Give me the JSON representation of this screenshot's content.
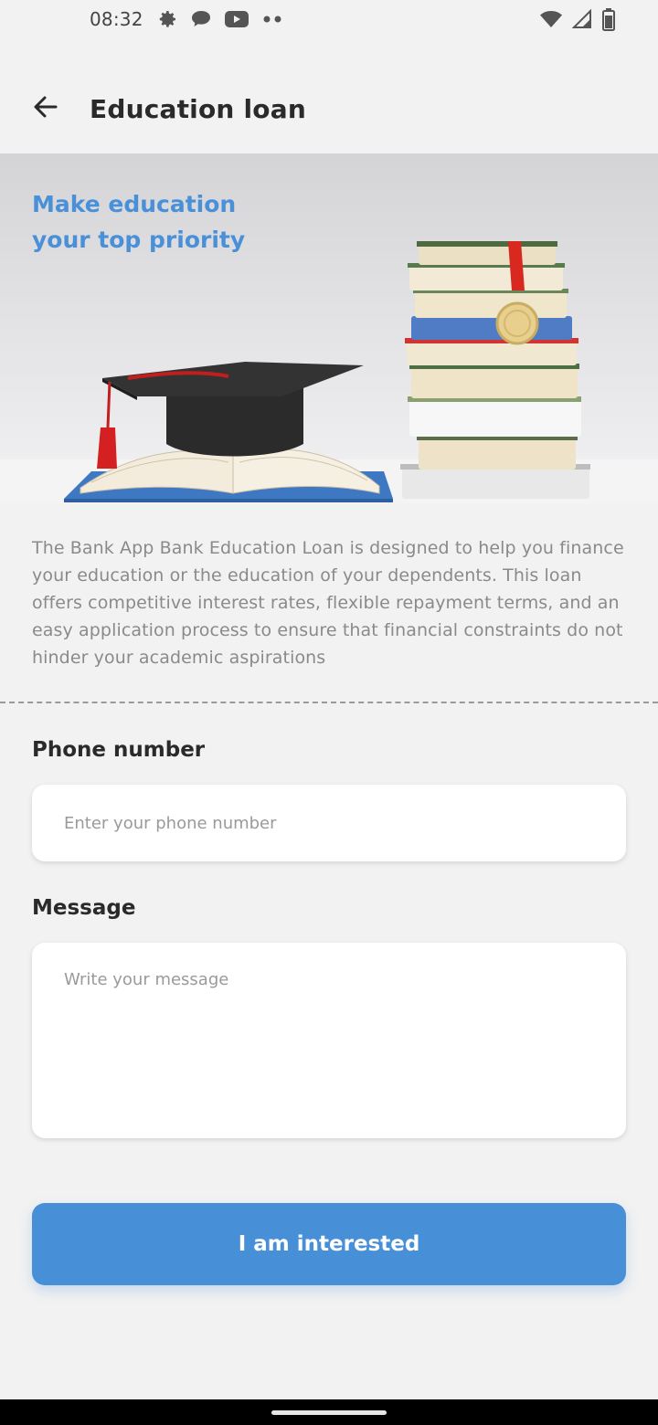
{
  "status_bar": {
    "time": "08:32",
    "left_icons": [
      "gear-icon",
      "chat-bubble-icon",
      "youtube-icon",
      "more-dots-icon"
    ],
    "right_icons": [
      "wifi-icon",
      "signal-icon",
      "battery-icon"
    ]
  },
  "app_bar": {
    "back_icon": "arrow-left-icon",
    "title": "Education loan"
  },
  "hero": {
    "tagline_line1": "Make education",
    "tagline_line2": "your top priority",
    "tagline_color": "#4a90d9"
  },
  "description": "The Bank App Bank Education Loan is designed to help you finance your education or the education of your dependents. This loan offers competitive interest rates, flexible repayment terms, and an easy application process to ensure that financial constraints do not hinder your academic aspirations",
  "form": {
    "phone_label": "Phone number",
    "phone_placeholder": "Enter your phone number",
    "phone_value": "",
    "message_label": "Message",
    "message_placeholder": "Write your message",
    "message_value": ""
  },
  "cta": {
    "label": "I am interested",
    "color": "#4790d8"
  }
}
